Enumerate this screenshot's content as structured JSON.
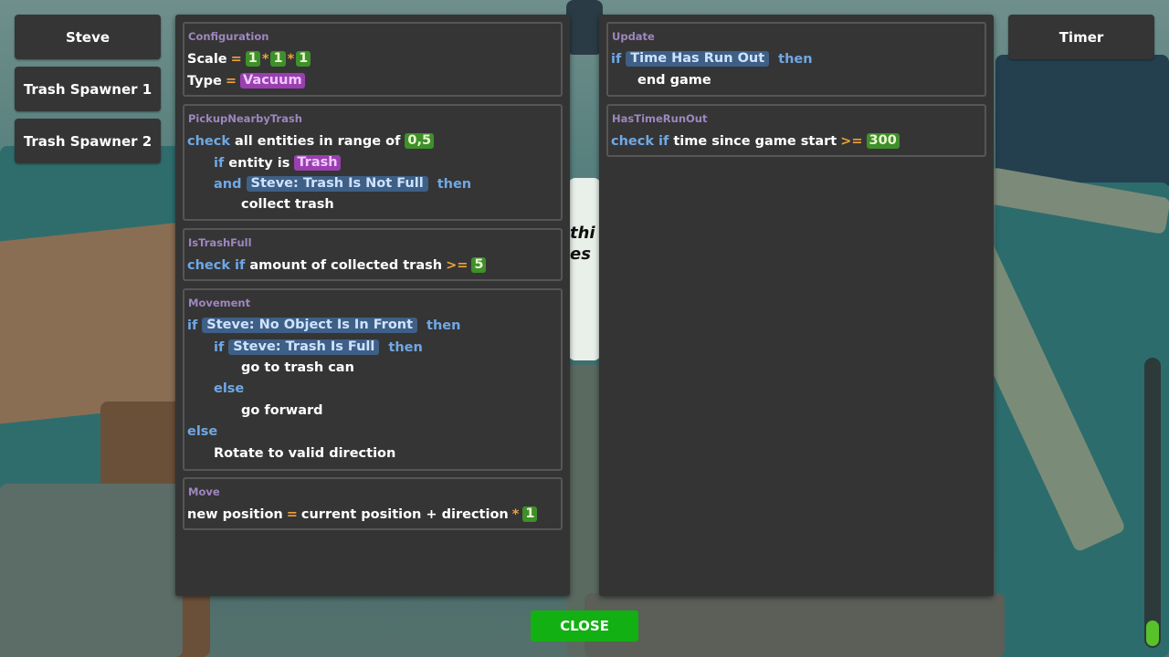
{
  "entities": [
    "Steve",
    "Trash Spawner 1",
    "Trash Spawner 2"
  ],
  "timer_label": "Timer",
  "close_label": "CLOSE",
  "scene_text": [
    "thi",
    "es"
  ],
  "progress_fraction": 0.09,
  "colors": {
    "keyword": "#6fa8e6",
    "operator": "#f0a23a",
    "number": "#3f8f2b",
    "type": "#9a3fb0",
    "condition": "#3e5f86",
    "title": "#9f86c0",
    "close": "#13b013"
  },
  "left_panel": {
    "configuration": {
      "title": "Configuration",
      "scale_label": "Scale",
      "eq": "=",
      "times": "*",
      "scale": [
        "1",
        "1",
        "1"
      ],
      "type_label": "Type",
      "type_value": "Vacuum"
    },
    "pickup": {
      "title": "PickupNearbyTrash",
      "check": "check",
      "range_text": "all entities in range of",
      "range_value": "0,5",
      "if": "if",
      "entity_is": "entity is",
      "entity_type": "Trash",
      "and": "and",
      "condition": "Steve: Trash Is Not Full",
      "then": "then",
      "action": "collect trash"
    },
    "is_trash_full": {
      "title": "IsTrashFull",
      "check_if": "check if",
      "text": "amount of collected trash",
      "op": ">=",
      "value": "5"
    },
    "movement": {
      "title": "Movement",
      "if": "if",
      "cond1": "Steve: No Object Is In Front",
      "then": "then",
      "cond2": "Steve: Trash Is Full",
      "action1": "go to trash can",
      "else": "else",
      "action2": "go forward",
      "action3": "Rotate to valid direction"
    },
    "move": {
      "title": "Move",
      "lhs": "new position",
      "eq": "=",
      "rhs": "current position + direction",
      "times": "*",
      "value": "1"
    }
  },
  "right_panel": {
    "update": {
      "title": "Update",
      "if": "if",
      "condition": "Time Has Run Out",
      "then": "then",
      "action": "end game"
    },
    "has_time_run_out": {
      "title": "HasTimeRunOut",
      "check_if": "check if",
      "text": "time since game start",
      "op": ">=",
      "value": "300"
    }
  }
}
